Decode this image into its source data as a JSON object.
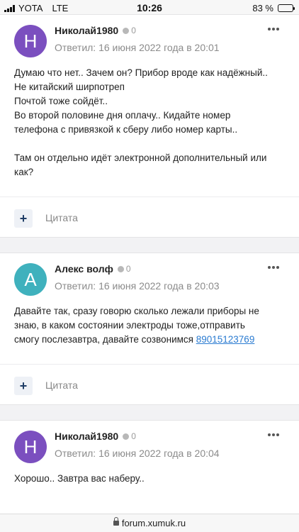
{
  "status_bar": {
    "carrier": "YOTA",
    "network": "LTE",
    "time": "10:26",
    "battery": "83 %",
    "battery_level": 0.83
  },
  "posts": [
    {
      "author": "Николай1980",
      "reputation": "0",
      "avatar_letter": "H",
      "avatar_color": "#7b4fbf",
      "date": "Ответил: 16 июня 2022 года в 20:01",
      "lines": [
        "Думаю что нет.. Зачем он? Прибор вроде как надёжный..",
        "Не китайский ширпотреп",
        "Почтой тоже сойдёт..",
        "Во второй половине дня оплачу.. Кидайте номер",
        "телефона с привязкой к сберу либо номер карты..",
        "Там он отдельно идёт электронной дополнительный или",
        "как?"
      ],
      "quote_label": "Цитата"
    },
    {
      "author": "Алекс волф",
      "reputation": "0",
      "avatar_letter": "A",
      "avatar_color": "#3fb1bd",
      "date": "Ответил: 16 июня 2022 года в 20:03",
      "lines": [
        "Давайте так, сразу говорю сколько лежали приборы не",
        "знаю, в каком состоянии электроды тоже,отправить",
        "смогу послезавтра, давайте созвонимся"
      ],
      "phone": "89015123769",
      "quote_label": "Цитата"
    },
    {
      "author": "Николай1980",
      "reputation": "0",
      "avatar_letter": "H",
      "avatar_color": "#7b4fbf",
      "date": "Ответил: 16 июня 2022 года в 20:04",
      "lines": [
        "Хорошо.. Завтра вас наберу.."
      ]
    }
  ],
  "url_bar": {
    "domain": "forum.xumuk.ru"
  }
}
